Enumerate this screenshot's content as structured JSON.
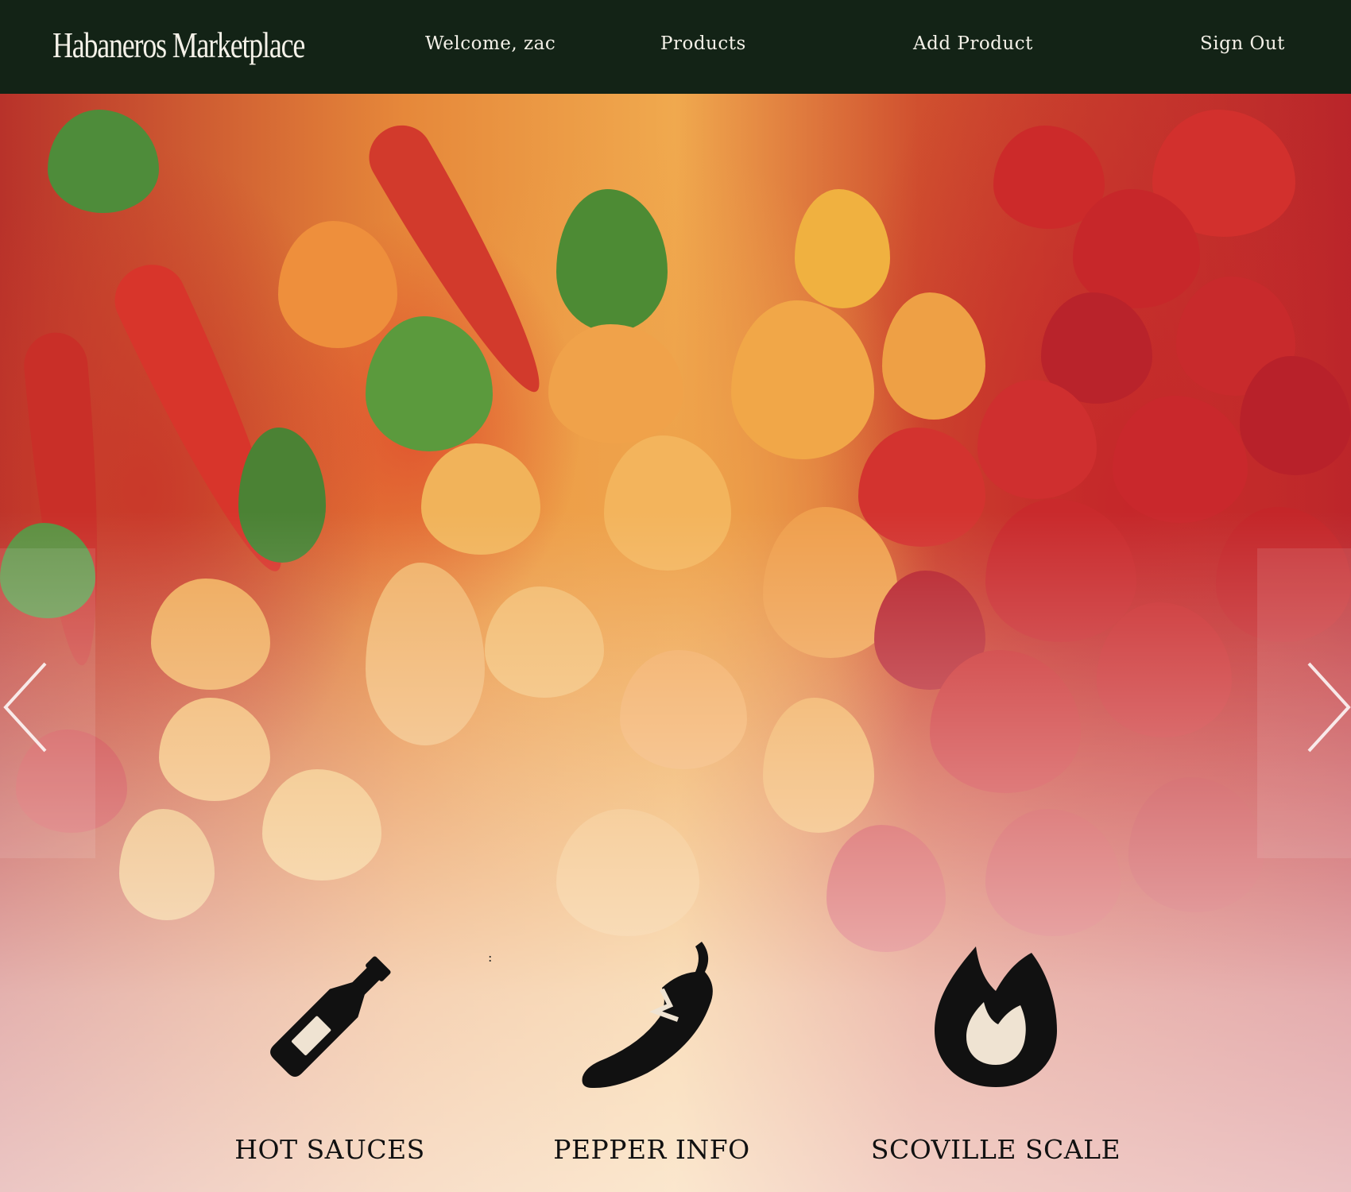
{
  "nav": {
    "brand": "Habaneros Marketplace",
    "welcome": "Welcome, zac",
    "products": "Products",
    "add_product": "Add Product",
    "sign_out": "Sign Out",
    "background": "#132316"
  },
  "hero": {
    "icons": {
      "prev": "chevron-left-icon",
      "next": "chevron-right-icon"
    }
  },
  "features": [
    {
      "label": "HOT SAUCES",
      "icon": "bottle-icon"
    },
    {
      "label": "PEPPER INFO",
      "icon": "chili-pepper-icon"
    },
    {
      "label": "SCOVILLE SCALE",
      "icon": "flame-icon"
    }
  ],
  "marker_text": ":",
  "colors": {
    "nav_bg": "#132316",
    "nav_text": "#f4f1e8",
    "icon": "#111111"
  }
}
